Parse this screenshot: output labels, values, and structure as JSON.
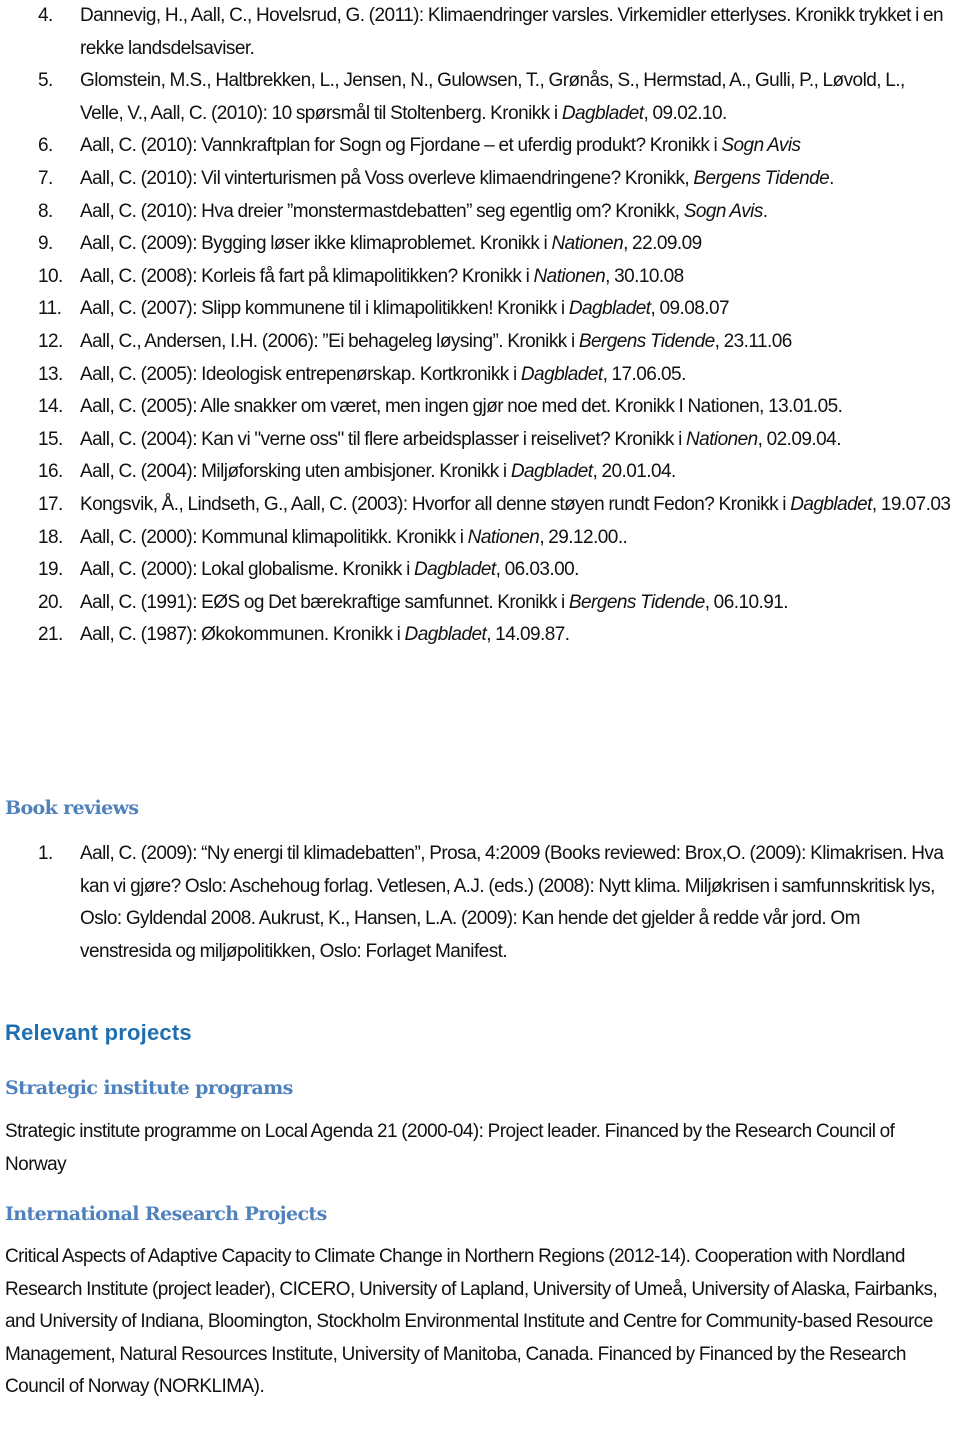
{
  "chronicles": {
    "items": [
      {
        "num": "4.",
        "parts": [
          {
            "t": "Dannevig, H., Aall, C., Hovelsrud, G. (2011): Klimaendringer varsles. Virkemidler etterlyses. Kronikk trykket i en rekke landsdelsaviser."
          }
        ]
      },
      {
        "num": "5.",
        "parts": [
          {
            "t": "Glomstein, M.S., Haltbrekken, L., Jensen, N., Gulowsen, T., Grønås, S., Hermstad, A., Gulli, P., Løvold, L., Velle, V., Aall, C. (2010): 10 spørsmål til Stoltenberg. Kronikk i "
          },
          {
            "t": "Dagbladet",
            "i": true
          },
          {
            "t": ", 09.02.10."
          }
        ]
      },
      {
        "num": "6.",
        "parts": [
          {
            "t": "Aall, C. (2010): Vannkraftplan for Sogn og Fjordane – et uferdig produkt? Kronikk i "
          },
          {
            "t": "Sogn Avis",
            "i": true
          }
        ]
      },
      {
        "num": "7.",
        "parts": [
          {
            "t": "Aall, C. (2010): Vil vinterturismen på Voss overleve klimaendringene? Kronikk, "
          },
          {
            "t": "Bergens Tidende",
            "i": true
          },
          {
            "t": "."
          }
        ]
      },
      {
        "num": "8.",
        "parts": [
          {
            "t": "Aall, C. (2010): Hva dreier ”monstermastdebatten” seg egentlig om? Kronikk, "
          },
          {
            "t": "Sogn Avis",
            "i": true
          },
          {
            "t": "."
          }
        ]
      },
      {
        "num": "9.",
        "parts": [
          {
            "t": "Aall, C. (2009): Bygging løser ikke klimaproblemet. Kronikk i "
          },
          {
            "t": "Nationen",
            "i": true
          },
          {
            "t": ", 22.09.09"
          }
        ]
      },
      {
        "num": "10.",
        "parts": [
          {
            "t": "Aall, C. (2008): Korleis få fart på klimapolitikken?  Kronikk i "
          },
          {
            "t": "Nationen",
            "i": true
          },
          {
            "t": ", 30.10.08"
          }
        ]
      },
      {
        "num": "11.",
        "parts": [
          {
            "t": "Aall, C. (2007): Slipp kommunene til i klimapolitikken! Kronikk i "
          },
          {
            "t": "Dagbladet",
            "i": true
          },
          {
            "t": ", 09.08.07"
          }
        ]
      },
      {
        "num": "12.",
        "parts": [
          {
            "t": "Aall, C., Andersen, I.H. (2006): ”Ei behageleg løysing”. Kronikk i "
          },
          {
            "t": "Bergens Tidende",
            "i": true
          },
          {
            "t": ", 23.11.06"
          }
        ]
      },
      {
        "num": "13.",
        "parts": [
          {
            "t": "Aall, C. (2005): Ideologisk entrepenørskap. Kortkronikk i "
          },
          {
            "t": "Dagbladet",
            "i": true
          },
          {
            "t": ", 17.06.05."
          }
        ]
      },
      {
        "num": "14.",
        "parts": [
          {
            "t": "Aall, C. (2005): Alle snakker om været, men ingen gjør noe med det.  Kronikk I Nationen, 13.01.05."
          }
        ]
      },
      {
        "num": "15.",
        "parts": [
          {
            "t": "Aall, C. (2004): Kan vi \"verne oss\" til flere arbeidsplasser i reiselivet? Kronikk i "
          },
          {
            "t": "Nationen",
            "i": true
          },
          {
            "t": ", 02.09.04."
          }
        ]
      },
      {
        "num": "16.",
        "parts": [
          {
            "t": "Aall, C. (2004): Miljøforsking uten ambisjoner. Kronikk i "
          },
          {
            "t": "Dagbladet",
            "i": true
          },
          {
            "t": ", 20.01.04."
          }
        ]
      },
      {
        "num": "17.",
        "parts": [
          {
            "t": "Kongsvik, Å., Lindseth, G., Aall, C. (2003): Hvorfor all denne støyen rundt Fedon? Kronikk i "
          },
          {
            "t": "Dagbladet",
            "i": true
          },
          {
            "t": ", 19.07.03"
          }
        ]
      },
      {
        "num": "18.",
        "parts": [
          {
            "t": "Aall, C. (2000): Kommunal klimapolitikk. Kronikk i "
          },
          {
            "t": "Nationen",
            "i": true
          },
          {
            "t": ", 29.12.00.."
          }
        ]
      },
      {
        "num": "19.",
        "parts": [
          {
            "t": "Aall, C. (2000): Lokal globalisme.  Kronikk i "
          },
          {
            "t": "Dagbladet",
            "i": true
          },
          {
            "t": ", 06.03.00."
          }
        ]
      },
      {
        "num": "20.",
        "parts": [
          {
            "t": "Aall, C. (1991): EØS og Det bærekraftige samfunnet. Kronikk i "
          },
          {
            "t": "Bergens Tidende",
            "i": true
          },
          {
            "t": ", 06.10.91."
          }
        ]
      },
      {
        "num": "21.",
        "parts": [
          {
            "t": "Aall, C. (1987): Økokommunen. Kronikk i "
          },
          {
            "t": "Dagbladet",
            "i": true
          },
          {
            "t": ", 14.09.87."
          }
        ]
      }
    ]
  },
  "book_reviews": {
    "heading": "Book reviews",
    "items": [
      {
        "num": "1.",
        "parts": [
          {
            "t": "Aall, C. (2009): “Ny energi til klimadebatten”, Prosa, 4:2009 (Books reviewed: Brox,O. (2009): Klimakrisen. Hva kan vi gjøre? Oslo: Aschehoug forlag. Vetlesen, A.J. (eds.) (2008): Nytt klima. Miljøkrisen i samfunnskritisk lys, Oslo: Gyldendal 2008. Aukrust, K., Hansen, L.A. (2009): Kan hende det gjelder å redde vår jord. Om venstresida og miljøpolitikken, Oslo: Forlaget Manifest."
          }
        ]
      }
    ]
  },
  "relevant_projects": {
    "heading": "Relevant projects",
    "strategic": {
      "heading": "Strategic institute programs",
      "text": "Strategic institute programme on Local Agenda 21 (2000-04): Project leader. Financed by the Research Council of Norway"
    },
    "international": {
      "heading": "International Research Projects",
      "text": "Critical Aspects of Adaptive Capacity to Climate Change in Northern Regions (2012-14). Cooperation with Nordland Research Institute (project leader), CICERO, University of Lapland, University of Umeå, University of Alaska, Fairbanks, and University of Indiana, Bloomington, Stockholm Environmental Institute and Centre for Community-based Resource Management, Natural Resources Institute, University of Manitoba, Canada. Financed by Financed by the Research Council of Norway (NORKLIMA)."
    }
  },
  "colors": {
    "heading_serif": "#4f81bd",
    "heading_sans": "#1f6fb0",
    "body_text": "#111111"
  }
}
